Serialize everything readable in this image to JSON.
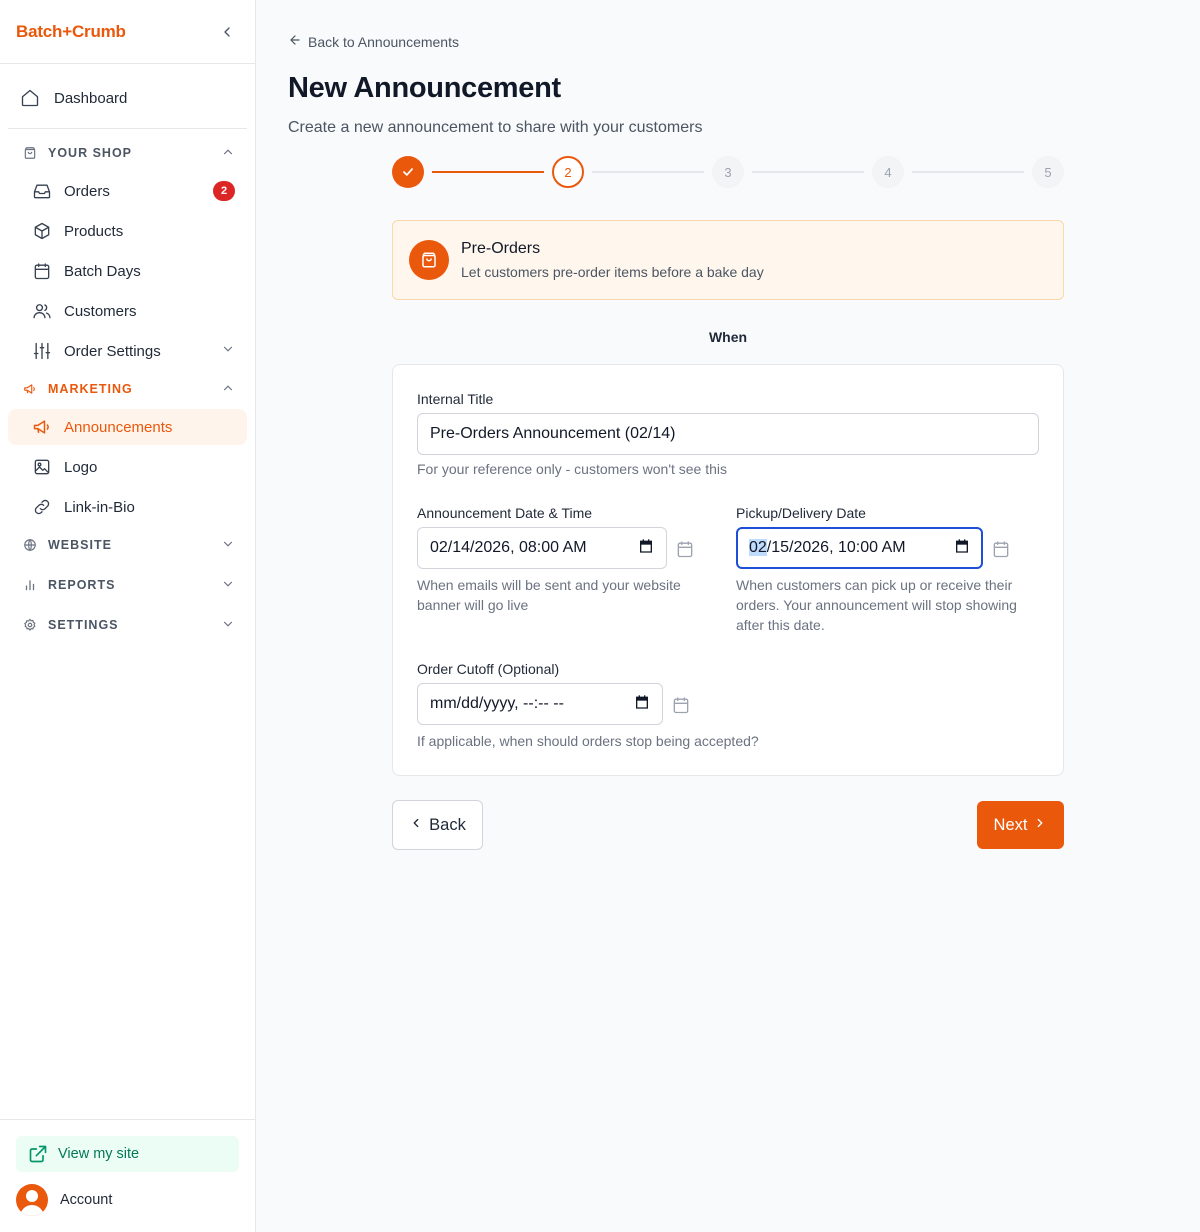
{
  "app": {
    "brand": "Batch+Crumb"
  },
  "sidebar": {
    "dashboard": "Dashboard",
    "your_shop": {
      "title": "YOUR SHOP",
      "items": [
        {
          "label": "Orders",
          "badge": "2",
          "icon": "inbox-icon"
        },
        {
          "label": "Products",
          "icon": "box-icon"
        },
        {
          "label": "Batch Days",
          "icon": "calendar-icon"
        },
        {
          "label": "Customers",
          "icon": "users-icon"
        },
        {
          "label": "Order Settings",
          "icon": "sliders-icon"
        }
      ]
    },
    "marketing": {
      "title": "MARKETING",
      "items": [
        {
          "label": "Announcements",
          "icon": "megaphone-icon",
          "active": true
        },
        {
          "label": "Logo",
          "icon": "image-icon"
        },
        {
          "label": "Link-in-Bio",
          "icon": "link-icon"
        }
      ]
    },
    "website": {
      "title": "WEBSITE"
    },
    "reports": {
      "title": "REPORTS"
    },
    "settings": {
      "title": "SETTINGS"
    },
    "footer": {
      "view_site": "View my site",
      "account": "Account"
    }
  },
  "page": {
    "back_link": "Back to Announcements",
    "title": "New Announcement",
    "subtitle": "Create a new announcement to share with your customers"
  },
  "stepper": {
    "steps": [
      {
        "label": "",
        "state": "done"
      },
      {
        "label": "2",
        "state": "current"
      },
      {
        "label": "3",
        "state": "pending"
      },
      {
        "label": "4",
        "state": "pending"
      },
      {
        "label": "5",
        "state": "pending"
      }
    ]
  },
  "type_card": {
    "title": "Pre-Orders",
    "description": "Let customers pre-order items before a bake day"
  },
  "section_label": "When",
  "form": {
    "internal_title": {
      "label": "Internal Title",
      "value": "Pre-Orders Announcement (02/14)",
      "help": "For your reference only - customers won't see this"
    },
    "announcement_date": {
      "label": "Announcement Date & Time",
      "value": "02/14/2026, 08:00 AM",
      "help": "When emails will be sent and your website banner will go live"
    },
    "pickup_date": {
      "label": "Pickup/Delivery Date",
      "value_highlight": "02",
      "value_rest": "/15/2026, 10:00 AM",
      "help": "When customers can pick up or receive their orders. Your announcement will stop showing after this date."
    },
    "order_cutoff": {
      "label": "Order Cutoff (Optional)",
      "value": "mm/dd/yyyy, --:-- --",
      "help": "If applicable, when should orders stop being accepted?"
    }
  },
  "actions": {
    "back": "Back",
    "next": "Next"
  },
  "colors": {
    "accent": "#ea580c",
    "badge": "#dc2626",
    "focus": "#1d4ed8"
  }
}
